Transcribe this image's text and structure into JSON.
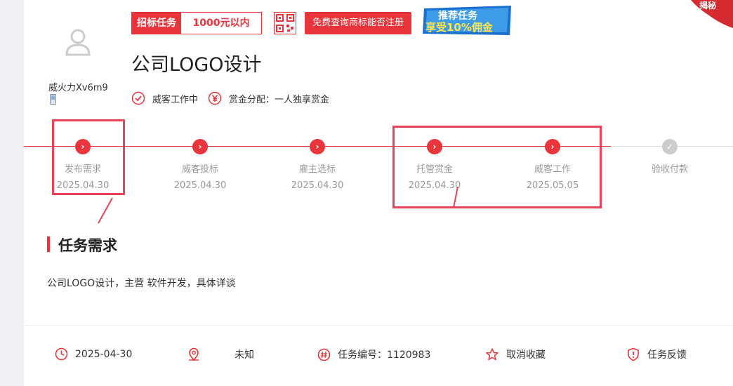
{
  "user": {
    "name": "威火力Xv6m9"
  },
  "task": {
    "type_tag": "招标任务",
    "budget": "1000元以内",
    "trademark_button": "免费查询商标能否注册",
    "title": "公司LOGO设计",
    "status": "威客工作中",
    "reward_mode": "赏金分配：一人独享赏金"
  },
  "promo": {
    "line1": "推荐任务",
    "line2": "享受10%佣金"
  },
  "corner_badge": "揭秘",
  "steps": [
    {
      "label": "发布需求",
      "date": "2025.04.30",
      "done": true
    },
    {
      "label": "威客投标",
      "date": "2025.04.30",
      "done": true
    },
    {
      "label": "雇主选标",
      "date": "2025.04.30",
      "done": true
    },
    {
      "label": "托管赏金",
      "date": "2025.04.30",
      "done": true
    },
    {
      "label": "威客工作",
      "date": "2025.05.05",
      "done": true
    },
    {
      "label": "验收付款",
      "date": "",
      "done": false
    }
  ],
  "requirements": {
    "heading": "任务需求",
    "text": "公司LOGO设计，主营 软件开发，具体详谈"
  },
  "footer": {
    "date": "2025-04-30",
    "location": "未知",
    "task_id": "任务编号：1120983",
    "favorite": "取消收藏",
    "feedback": "任务反馈"
  },
  "colors": {
    "accent": "#e8343a",
    "highlight_box": "#e8435a"
  }
}
